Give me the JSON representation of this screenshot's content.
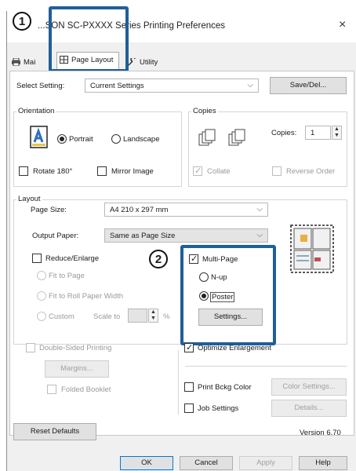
{
  "window": {
    "title": "...SON SC-PXXXX Series Printing Preferences",
    "close_glyph": "×"
  },
  "tabs": [
    {
      "label": "Mai"
    },
    {
      "label": "Page Layout"
    },
    {
      "label": "Utility"
    }
  ],
  "top": {
    "select_setting_label": "Select Setting:",
    "select_setting_value": "Current Settings",
    "save_del_button": "Save/Del..."
  },
  "orientation": {
    "group_label": "Orientation",
    "portrait_label": "Portrait",
    "landscape_label": "Landscape",
    "selected": "Portrait",
    "rotate_label": "Rotate 180°",
    "mirror_label": "Mirror Image"
  },
  "copies": {
    "group_label": "Copies",
    "copies_label": "Copies:",
    "copies_value": "1",
    "collate_label": "Collate",
    "reverse_label": "Reverse Order"
  },
  "layout": {
    "group_label": "Layout",
    "page_size_label": "Page Size:",
    "page_size_value": "A4 210 x 297 mm",
    "output_paper_label": "Output Paper:",
    "output_paper_value": "Same as Page Size",
    "reduce_label": "Reduce/Enlarge",
    "fit_page_label": "Fit to Page",
    "fit_roll_label": "Fit to Roll Paper Width",
    "custom_label": "Custom",
    "scale_label": "Scale to",
    "scale_unit": "%",
    "multi_page_label": "Multi-Page",
    "nup_label": "N-up",
    "poster_label": "Poster",
    "settings_button": "Settings...",
    "multi_page_checked": true,
    "selected_mode": "Poster"
  },
  "lower": {
    "double_sided_label": "Double-Sided Printing",
    "margins_button": "Margins...",
    "folded_label": "Folded Booklet",
    "optimize_label": "Optimize Enlargement",
    "print_bkg_label": "Print Bckg Color",
    "color_settings_button": "Color Settings...",
    "job_settings_label": "Job Settings",
    "details_button": "Details...",
    "optimize_checked": true
  },
  "footer": {
    "reset_button": "Reset Defaults",
    "version": "Version 6.70",
    "ok_button": "OK",
    "cancel_button": "Cancel",
    "apply_button": "Apply",
    "help_button": "Help"
  },
  "callouts": {
    "one": "1",
    "two": "2",
    "highlight_color": "#1f5f9a"
  }
}
